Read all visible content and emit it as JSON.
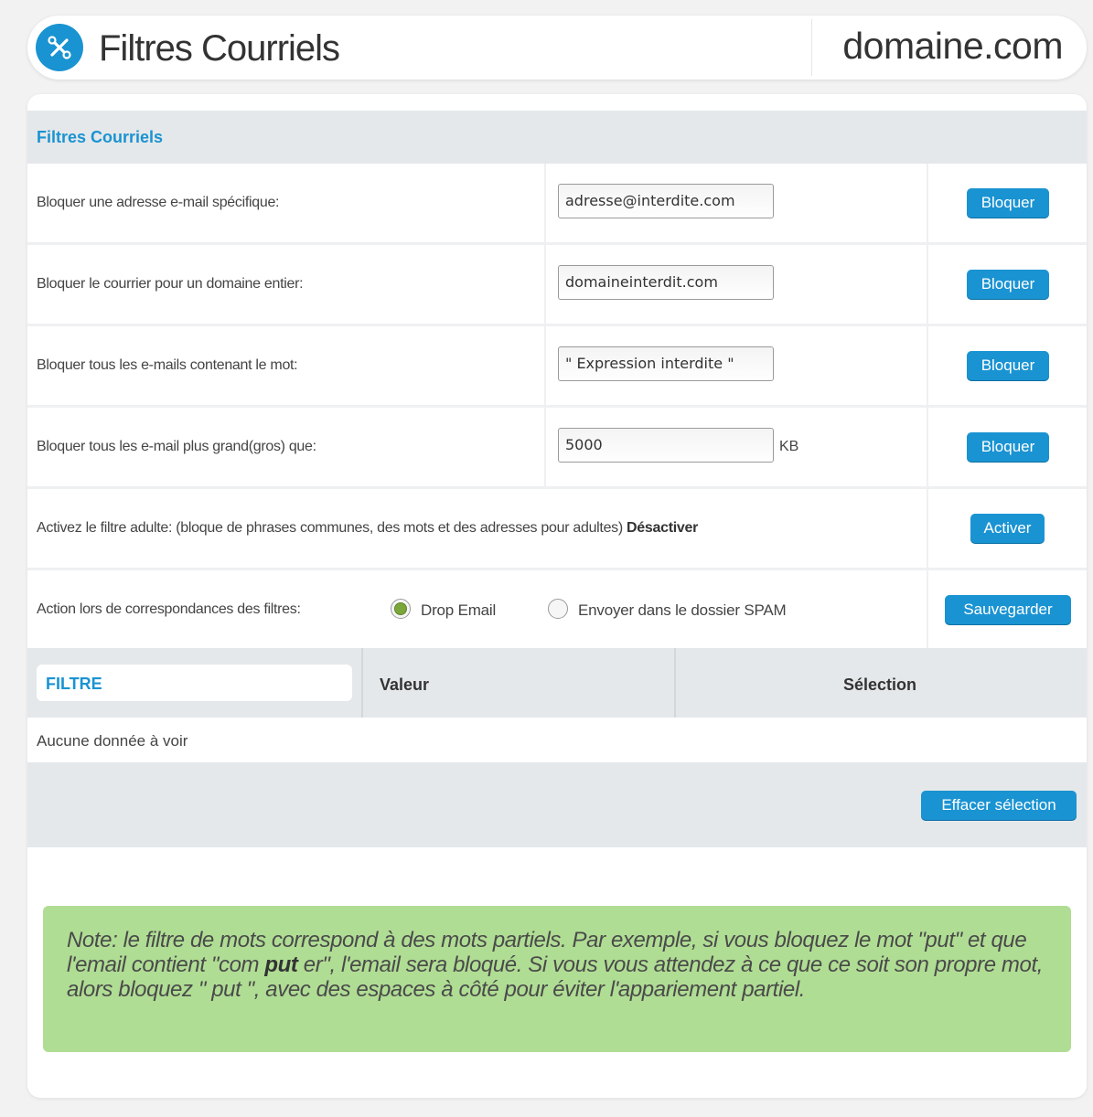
{
  "header": {
    "logo_icon": "tools-cross-icon",
    "title": "Filtres Courriels",
    "domain": "domaine.com"
  },
  "panel": {
    "title": "Filtres Courriels",
    "rows": [
      {
        "label": "Bloquer une adresse e-mail spécifique:",
        "value": "adresse@interdite.com",
        "button": "Bloquer"
      },
      {
        "label": "Bloquer le courrier pour un domaine entier:",
        "value": "domaineinterdit.com",
        "button": "Bloquer"
      },
      {
        "label": "Bloquer tous les e-mails contenant le mot:",
        "value": "\" Expression interdite \"",
        "button": "Bloquer"
      },
      {
        "label": "Bloquer tous les e-mail plus grand(gros) que:",
        "value": "5000",
        "unit": "KB",
        "button": "Bloquer"
      }
    ],
    "adult_filter": {
      "label": "Activez le filtre adulte: (bloque de phrases communes, des mots et des adresses pour adultes)",
      "status": "Désactiver",
      "button": "Activer"
    },
    "action": {
      "label": "Action lors de correspondances des filtres:",
      "options": [
        "Drop Email",
        "Envoyer dans le dossier SPAM"
      ],
      "selected": "Drop Email",
      "button": "Sauvegarder"
    },
    "table": {
      "columns": [
        "FILTRE",
        "Valeur",
        "Sélection"
      ],
      "empty_text": "Aucune donnée à voir",
      "clear_button": "Effacer sélection"
    },
    "note": {
      "part1": "Note: le filtre de mots correspond à des mots partiels. Par exemple, si vous bloquez le mot \"put\" et que l'email contient \"com ",
      "bold": "put",
      "part2": " er\", l'email sera bloqué. Si vous vous attendez à ce que ce soit son propre mot, alors bloquez \"  put  \", avec des espaces à côté pour éviter l'appariement partiel."
    }
  },
  "colors": {
    "accent": "#1a93d2",
    "note_background": "#b0dd94",
    "header_strip": "#e5e8ea",
    "radio_selected": "#7aa63a"
  }
}
